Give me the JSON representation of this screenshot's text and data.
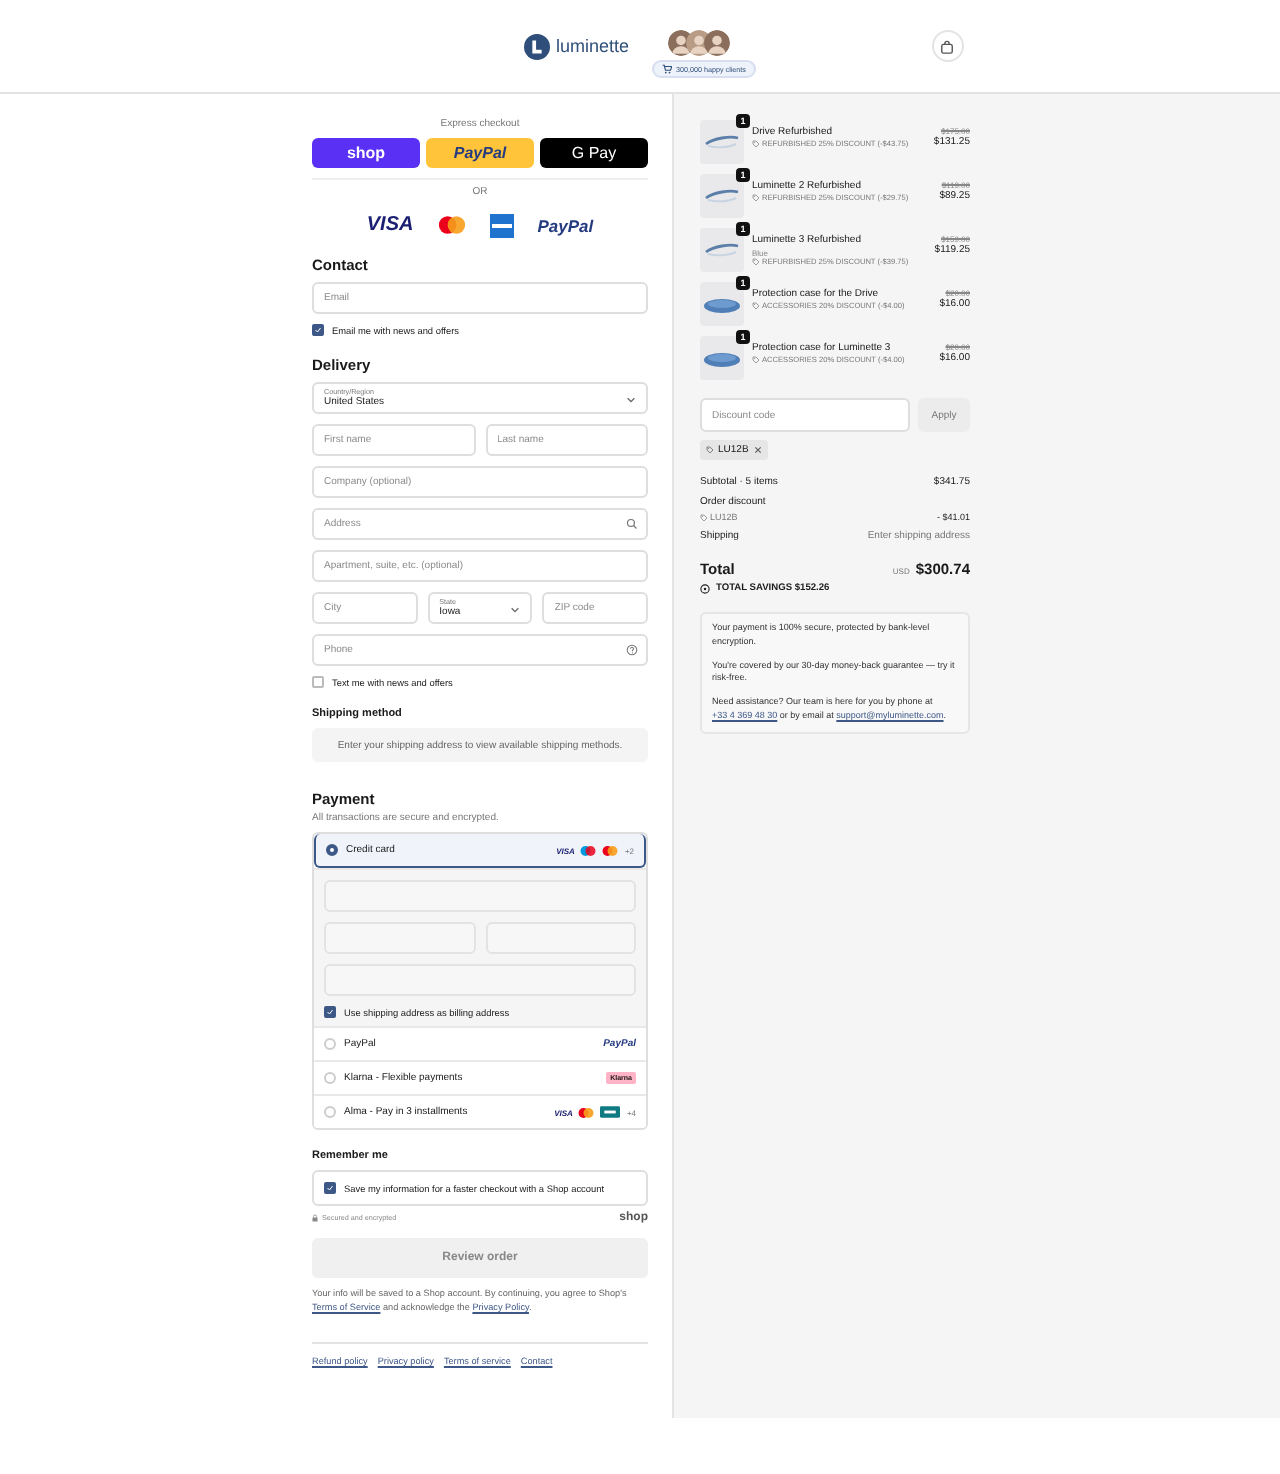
{
  "header": {
    "logo": "luminette",
    "badge": "300,000 happy clients"
  },
  "express": {
    "title": "Express checkout",
    "buttons": [
      {
        "kind": "shop",
        "label": "shop"
      },
      {
        "kind": "paypal",
        "label": "PayPal"
      },
      {
        "kind": "gpay",
        "label": "G Pay"
      }
    ],
    "separator": "OR"
  },
  "card_logos": [
    {
      "kind": "visa",
      "label": "VISA"
    },
    {
      "kind": "mastercard"
    },
    {
      "kind": "amex"
    },
    {
      "kind": "paypal",
      "label": "PayPal"
    }
  ],
  "contact": {
    "title": "Contact",
    "email": {
      "placeholder": "Email"
    },
    "newsletter": {
      "label": "Email me with news and offers",
      "checked": true
    }
  },
  "delivery": {
    "title": "Delivery",
    "country": {
      "label": "Country/Region",
      "value": "United States"
    },
    "first_name": {
      "placeholder": "First name"
    },
    "last_name": {
      "placeholder": "Last name"
    },
    "company": {
      "placeholder": "Company (optional)"
    },
    "address": {
      "placeholder": "Address"
    },
    "apartment": {
      "placeholder": "Apartment, suite, etc. (optional)"
    },
    "city": {
      "placeholder": "City"
    },
    "state": {
      "label": "State",
      "value": "Iowa"
    },
    "zip": {
      "placeholder": "ZIP code"
    },
    "phone": {
      "placeholder": "Phone"
    },
    "sms": {
      "label": "Text me with news and offers",
      "checked": false
    }
  },
  "shipping": {
    "title": "Shipping method",
    "message": "Enter your shipping address to view available shipping methods."
  },
  "payment": {
    "title": "Payment",
    "subtitle": "All transactions are secure and encrypted.",
    "methods": [
      {
        "kind": "card",
        "label": "Credit card",
        "selected": true,
        "brand": "VISA",
        "more": "+2"
      },
      {
        "kind": "paypal",
        "label": "PayPal",
        "selected": false,
        "logo": "PayPal"
      },
      {
        "kind": "klarna",
        "label": "Klarna - Flexible payments",
        "selected": false,
        "logo": "Klarna"
      },
      {
        "kind": "alma",
        "label": "Alma - Pay in 3 installments",
        "selected": false,
        "brand": "VISA",
        "more": "+4"
      }
    ],
    "billing": {
      "label": "Use shipping address as billing address",
      "checked": true
    }
  },
  "remember": {
    "title": "Remember me",
    "save": {
      "label": "Save my information for a faster checkout with a Shop account",
      "checked": true
    },
    "secure": "Secured and encrypted",
    "shop": "shop"
  },
  "review_button": "Review order",
  "legal": {
    "before": "Your info will be saved to a Shop account. By continuing, you agree to Shop's ",
    "link1": "Terms of Service",
    "middle": " and acknowledge the ",
    "link2": "Privacy Policy",
    "after": "."
  },
  "footer_links": [
    "Refund policy",
    "Privacy policy",
    "Terms of service",
    "Contact"
  ],
  "items": [
    {
      "kind": "glasses",
      "quantity": "1",
      "name": "Drive Refurbished",
      "discount": "REFURBISHED 25% DISCOUNT (-$43.75)",
      "old_price": "$175.00",
      "price": "$131.25"
    },
    {
      "kind": "glasses",
      "quantity": "1",
      "name": "Luminette 2 Refurbished",
      "discount": "REFURBISHED 25% DISCOUNT (-$29.75)",
      "old_price": "$119.00",
      "price": "$89.25"
    },
    {
      "kind": "glasses",
      "quantity": "1",
      "name": "Luminette 3 Refurbished",
      "variant": "Blue",
      "discount": "REFURBISHED 25% DISCOUNT (-$39.75)",
      "old_price": "$159.00",
      "price": "$119.25"
    },
    {
      "kind": "case",
      "quantity": "1",
      "name": "Protection case for the Drive",
      "discount": "ACCESSORIES 20% DISCOUNT (-$4.00)",
      "old_price": "$20.00",
      "price": "$16.00"
    },
    {
      "kind": "case",
      "quantity": "1",
      "name": "Protection case for Luminette 3",
      "discount": "ACCESSORIES 20% DISCOUNT (-$4.00)",
      "old_price": "$20.00",
      "price": "$16.00"
    }
  ],
  "discount": {
    "placeholder": "Discount code",
    "button": "Apply",
    "code": "LU12B"
  },
  "summary": {
    "subtotal_label": "Subtotal · 5 items",
    "subtotal": "$341.75",
    "order_discount": "Order discount",
    "code": "LU12B",
    "discount_value": "- $41.01",
    "shipping_label": "Shipping",
    "shipping_value": "Enter shipping address",
    "total_label": "Total",
    "currency": "USD",
    "total": "$300.74",
    "savings": "TOTAL SAVINGS $152.26"
  },
  "info": {
    "secure": "Your payment is 100% secure, protected by bank-level encryption.",
    "guarantee": "You're covered by our 30-day money-back guarantee — try it risk-free.",
    "help_before": "Need assistance? Our team is here for you by phone at ",
    "phone": "+33 4 369 48 30",
    "help_middle": " or by email at ",
    "email": "support@myluminette.com",
    "help_after": "."
  }
}
